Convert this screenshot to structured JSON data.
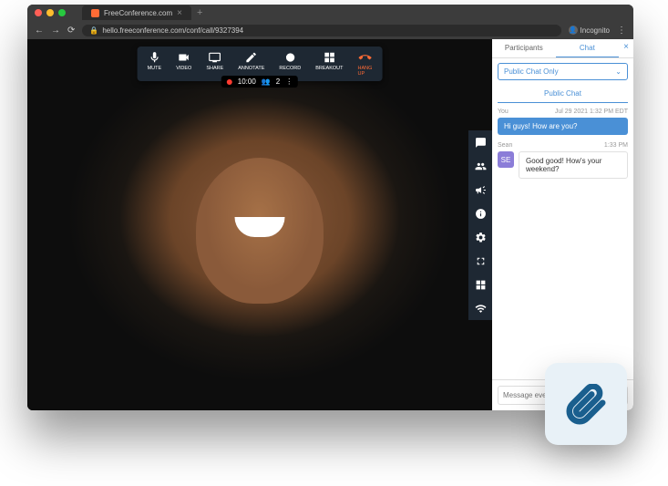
{
  "browser": {
    "tab_title": "FreeConference.com",
    "url": "hello.freeconference.com/conf/call/9327394",
    "incognito_label": "Incognito"
  },
  "toolbar": {
    "mute": "MUTE",
    "video": "VIDEO",
    "share": "SHARE",
    "annotate": "ANNOTATE",
    "record": "RECORD",
    "breakout": "BREAKOUT",
    "hangup": "HANG UP"
  },
  "status": {
    "time": "10:00",
    "participants": "2",
    "more": "⋮"
  },
  "side": {
    "items": [
      "chat",
      "participants",
      "announce",
      "info",
      "settings",
      "fullscreen",
      "grid",
      "wifi"
    ]
  },
  "chat": {
    "tabs": {
      "participants": "Participants",
      "chat": "Chat"
    },
    "dropdown": "Public Chat Only",
    "section_header": "Public Chat",
    "msgs": [
      {
        "sender": "You",
        "ts": "Jul 29 2021 1:32 PM EDT",
        "text": "Hi guys! How are you?",
        "mine": true
      },
      {
        "sender": "Sean",
        "initials": "SE",
        "ts": "1:33 PM",
        "text": "Good good! How's your weekend?",
        "mine": false
      }
    ],
    "input_placeholder": "Message everyone..."
  }
}
